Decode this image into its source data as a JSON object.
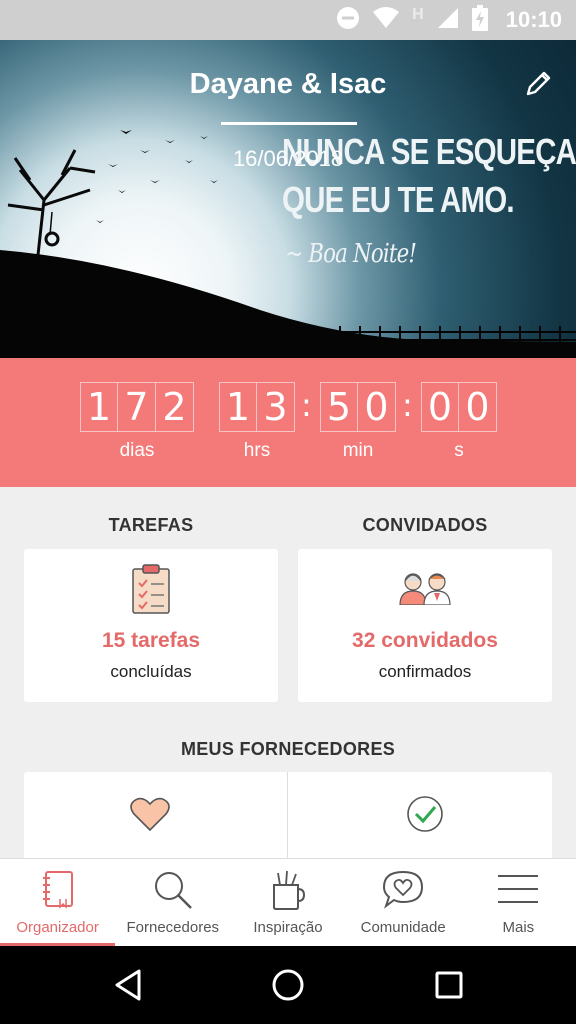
{
  "status_bar": {
    "time": "10:10",
    "network_label": "H"
  },
  "hero": {
    "title": "Dayane & Isac",
    "date": "16/06/2018",
    "quote_line1": "NUNCA SE ESQUEÇA",
    "quote_line2": "QUE EU TE AMO.",
    "quote_sign": "~ Boa Noite!"
  },
  "countdown": {
    "days": [
      "1",
      "7",
      "2"
    ],
    "hours": [
      "1",
      "3"
    ],
    "minutes": [
      "5",
      "0"
    ],
    "seconds": [
      "0",
      "0"
    ],
    "labels": {
      "days": "dias",
      "hours": "hrs",
      "minutes": "min",
      "seconds": "s"
    },
    "color": "#f47a7a"
  },
  "sections": {
    "tasks": {
      "title": "TAREFAS",
      "count": "15 tarefas",
      "subtitle": "concluídas"
    },
    "guests": {
      "title": "CONVIDADOS",
      "count": "32 convidados",
      "subtitle": "confirmados"
    },
    "vendors": {
      "title": "MEUS FORNECEDORES"
    }
  },
  "tabs": [
    {
      "label": "Organizador",
      "icon": "notebook-icon",
      "active": true
    },
    {
      "label": "Fornecedores",
      "icon": "search-icon"
    },
    {
      "label": "Inspiração",
      "icon": "inspiration-icon"
    },
    {
      "label": "Comunidade",
      "icon": "chat-heart-icon"
    },
    {
      "label": "Mais",
      "icon": "menu-icon"
    }
  ],
  "accent_color": "#e46a6a"
}
